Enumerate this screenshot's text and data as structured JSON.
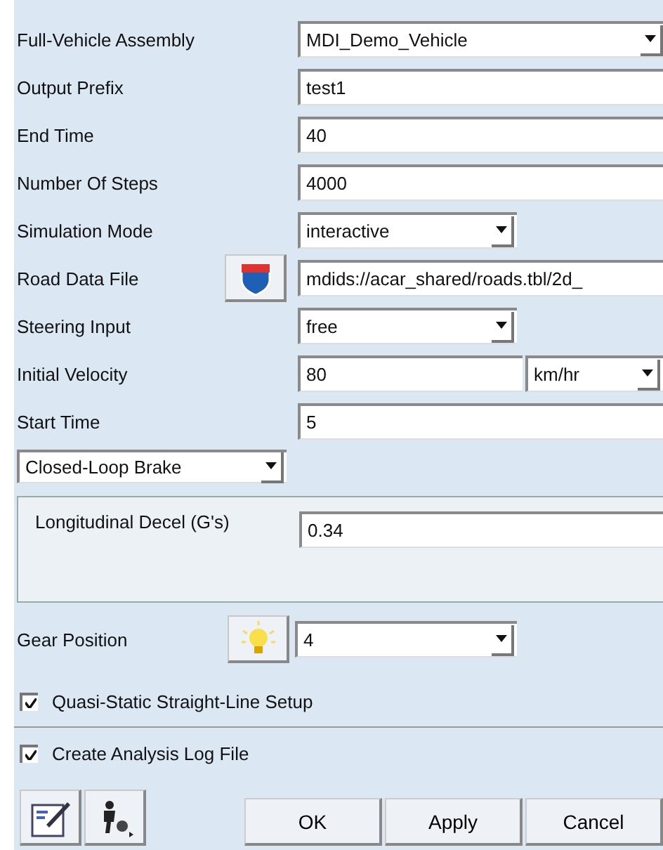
{
  "rows": [
    {
      "kind": "dropdown_wide",
      "label": "Full-Vehicle Assembly",
      "value": "MDI_Demo_Vehicle"
    },
    {
      "kind": "text",
      "label": "Output Prefix",
      "value": "test1"
    },
    {
      "kind": "text",
      "label": "End Time",
      "value": "40"
    },
    {
      "kind": "text",
      "label": "Number Of Steps",
      "value": "4000"
    },
    {
      "kind": "dropdown",
      "label": "Simulation Mode",
      "value": "interactive"
    },
    {
      "kind": "file",
      "label": "Road Data File",
      "value": "mdids://acar_shared/roads.tbl/2d_"
    },
    {
      "kind": "dropdown",
      "label": "Steering Input",
      "value": "free"
    },
    {
      "kind": "value_unit",
      "label": "Initial Velocity",
      "value": "80",
      "unit": "km/hr"
    },
    {
      "kind": "text",
      "label": "Start Time",
      "value": "5"
    }
  ],
  "brake_mode": {
    "value": "Closed-Loop Brake"
  },
  "brake_panel": {
    "label": "Longitudinal Decel (G's)",
    "value": "0.34"
  },
  "gear": {
    "label": "Gear Position",
    "value": "4"
  },
  "checkboxes": [
    {
      "label": "Quasi-Static Straight-Line Setup",
      "checked": true
    },
    {
      "label": "Create Analysis Log File",
      "checked": true
    }
  ],
  "buttons": [
    "OK",
    "Apply",
    "Cancel"
  ]
}
